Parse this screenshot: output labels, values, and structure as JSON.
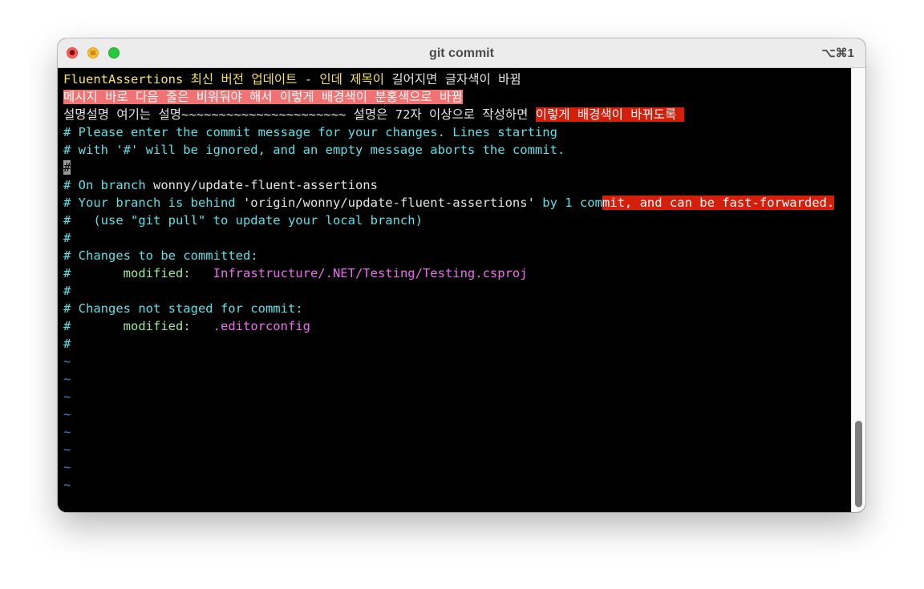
{
  "window": {
    "title": "git commit",
    "shortcut": "⌥⌘1"
  },
  "editor": {
    "line1": {
      "yellow": "FluentAssertions 최신 버전 업데이트 - 인데 제목이",
      "rest": " 길어지면 글자색이 바뀜"
    },
    "line2": {
      "highlight": "메시지 바로 다음 줄은 비워둬야 해서 이렇게 배경색이 분홍색으로 바뀜"
    },
    "line3": {
      "plain": "설명설명 여기는 설명~~~~~~~~~~~~~~~~~~~~~~ 설명은 72자 이상으로 작성하면 ",
      "highlight": "이렇게 배경색이 바뀌도록 "
    },
    "line4": "# Please enter the commit message for your changes. Lines starting",
    "line5": "# with '#' will be ignored, and an empty message aborts the commit.",
    "line6": {
      "cursor": "#"
    },
    "line7": {
      "prefix": "# On branch ",
      "branch": "wonny/update-fluent-assertions"
    },
    "line8": {
      "prefix": "# Your branch is behind ",
      "remote": "'origin/wonny/update-fluent-assertions'",
      "middle": " by 1 com",
      "highlight": "mit, and can be fast-forwarded."
    },
    "line9": "#   (use \"git pull\" to update your local branch)",
    "line10": "#",
    "line11": "# Changes to be committed:",
    "line12": {
      "hash": "#",
      "label": "       modified:   ",
      "file": "Infrastructure/.NET/Testing/Testing.csproj"
    },
    "line13": "#",
    "line14": "# Changes not staged for commit:",
    "line15": {
      "hash": "#",
      "label": "       modified:   ",
      "file": ".editorconfig"
    },
    "line16": "#",
    "tildes": [
      "~",
      "~",
      "~",
      "~",
      "~",
      "~",
      "~",
      "~"
    ]
  },
  "colors": {
    "comment": "#5ce1e6",
    "label": "#9ee89e",
    "file": "#ee6cf0",
    "subject": "#f6e45c",
    "highlight_pink": "#f07272",
    "highlight_red": "#d51f0d",
    "tilde": "#3f86d6"
  },
  "icons": {
    "close": "close-icon",
    "minimize": "minimize-icon",
    "zoom": "zoom-icon"
  }
}
